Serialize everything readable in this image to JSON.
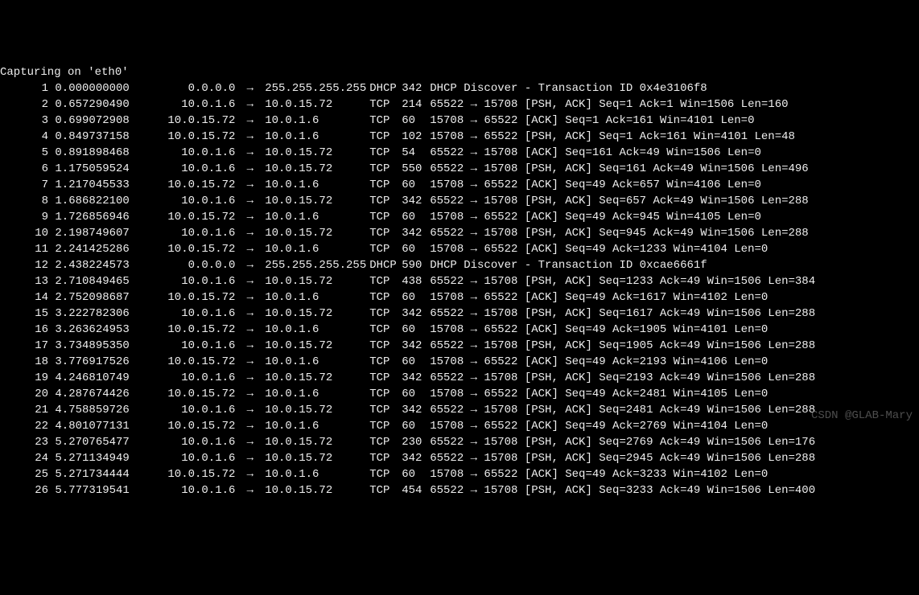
{
  "header": "Capturing on 'eth0'",
  "arrow": "→",
  "watermark": "CSDN @GLAB-Mary",
  "packets": [
    {
      "no": "1",
      "time": "0.000000000",
      "src": "0.0.0.0",
      "dst": "255.255.255.255",
      "proto": "DHCP",
      "len": "342",
      "info": "DHCP Discover - Transaction ID 0x4e3106f8"
    },
    {
      "no": "2",
      "time": "0.657290490",
      "src": "10.0.1.6",
      "dst": "10.0.15.72",
      "proto": "TCP",
      "len": "214",
      "info": "65522 → 15708 [PSH, ACK] Seq=1 Ack=1 Win=1506 Len=160"
    },
    {
      "no": "3",
      "time": "0.699072908",
      "src": "10.0.15.72",
      "dst": "10.0.1.6",
      "proto": "TCP",
      "len": "60",
      "info": "15708 → 65522 [ACK] Seq=1 Ack=161 Win=4101 Len=0"
    },
    {
      "no": "4",
      "time": "0.849737158",
      "src": "10.0.15.72",
      "dst": "10.0.1.6",
      "proto": "TCP",
      "len": "102",
      "info": "15708 → 65522 [PSH, ACK] Seq=1 Ack=161 Win=4101 Len=48"
    },
    {
      "no": "5",
      "time": "0.891898468",
      "src": "10.0.1.6",
      "dst": "10.0.15.72",
      "proto": "TCP",
      "len": "54",
      "info": "65522 → 15708 [ACK] Seq=161 Ack=49 Win=1506 Len=0"
    },
    {
      "no": "6",
      "time": "1.175059524",
      "src": "10.0.1.6",
      "dst": "10.0.15.72",
      "proto": "TCP",
      "len": "550",
      "info": "65522 → 15708 [PSH, ACK] Seq=161 Ack=49 Win=1506 Len=496"
    },
    {
      "no": "7",
      "time": "1.217045533",
      "src": "10.0.15.72",
      "dst": "10.0.1.6",
      "proto": "TCP",
      "len": "60",
      "info": "15708 → 65522 [ACK] Seq=49 Ack=657 Win=4106 Len=0"
    },
    {
      "no": "8",
      "time": "1.686822100",
      "src": "10.0.1.6",
      "dst": "10.0.15.72",
      "proto": "TCP",
      "len": "342",
      "info": "65522 → 15708 [PSH, ACK] Seq=657 Ack=49 Win=1506 Len=288"
    },
    {
      "no": "9",
      "time": "1.726856946",
      "src": "10.0.15.72",
      "dst": "10.0.1.6",
      "proto": "TCP",
      "len": "60",
      "info": "15708 → 65522 [ACK] Seq=49 Ack=945 Win=4105 Len=0"
    },
    {
      "no": "10",
      "time": "2.198749607",
      "src": "10.0.1.6",
      "dst": "10.0.15.72",
      "proto": "TCP",
      "len": "342",
      "info": "65522 → 15708 [PSH, ACK] Seq=945 Ack=49 Win=1506 Len=288"
    },
    {
      "no": "11",
      "time": "2.241425286",
      "src": "10.0.15.72",
      "dst": "10.0.1.6",
      "proto": "TCP",
      "len": "60",
      "info": "15708 → 65522 [ACK] Seq=49 Ack=1233 Win=4104 Len=0"
    },
    {
      "no": "12",
      "time": "2.438224573",
      "src": "0.0.0.0",
      "dst": "255.255.255.255",
      "proto": "DHCP",
      "len": "590",
      "info": "DHCP Discover - Transaction ID 0xcae6661f"
    },
    {
      "no": "13",
      "time": "2.710849465",
      "src": "10.0.1.6",
      "dst": "10.0.15.72",
      "proto": "TCP",
      "len": "438",
      "info": "65522 → 15708 [PSH, ACK] Seq=1233 Ack=49 Win=1506 Len=384"
    },
    {
      "no": "14",
      "time": "2.752098687",
      "src": "10.0.15.72",
      "dst": "10.0.1.6",
      "proto": "TCP",
      "len": "60",
      "info": "15708 → 65522 [ACK] Seq=49 Ack=1617 Win=4102 Len=0"
    },
    {
      "no": "15",
      "time": "3.222782306",
      "src": "10.0.1.6",
      "dst": "10.0.15.72",
      "proto": "TCP",
      "len": "342",
      "info": "65522 → 15708 [PSH, ACK] Seq=1617 Ack=49 Win=1506 Len=288"
    },
    {
      "no": "16",
      "time": "3.263624953",
      "src": "10.0.15.72",
      "dst": "10.0.1.6",
      "proto": "TCP",
      "len": "60",
      "info": "15708 → 65522 [ACK] Seq=49 Ack=1905 Win=4101 Len=0"
    },
    {
      "no": "17",
      "time": "3.734895350",
      "src": "10.0.1.6",
      "dst": "10.0.15.72",
      "proto": "TCP",
      "len": "342",
      "info": "65522 → 15708 [PSH, ACK] Seq=1905 Ack=49 Win=1506 Len=288"
    },
    {
      "no": "18",
      "time": "3.776917526",
      "src": "10.0.15.72",
      "dst": "10.0.1.6",
      "proto": "TCP",
      "len": "60",
      "info": "15708 → 65522 [ACK] Seq=49 Ack=2193 Win=4106 Len=0"
    },
    {
      "no": "19",
      "time": "4.246810749",
      "src": "10.0.1.6",
      "dst": "10.0.15.72",
      "proto": "TCP",
      "len": "342",
      "info": "65522 → 15708 [PSH, ACK] Seq=2193 Ack=49 Win=1506 Len=288"
    },
    {
      "no": "20",
      "time": "4.287674426",
      "src": "10.0.15.72",
      "dst": "10.0.1.6",
      "proto": "TCP",
      "len": "60",
      "info": "15708 → 65522 [ACK] Seq=49 Ack=2481 Win=4105 Len=0"
    },
    {
      "no": "21",
      "time": "4.758859726",
      "src": "10.0.1.6",
      "dst": "10.0.15.72",
      "proto": "TCP",
      "len": "342",
      "info": "65522 → 15708 [PSH, ACK] Seq=2481 Ack=49 Win=1506 Len=288"
    },
    {
      "no": "22",
      "time": "4.801077131",
      "src": "10.0.15.72",
      "dst": "10.0.1.6",
      "proto": "TCP",
      "len": "60",
      "info": "15708 → 65522 [ACK] Seq=49 Ack=2769 Win=4104 Len=0"
    },
    {
      "no": "23",
      "time": "5.270765477",
      "src": "10.0.1.6",
      "dst": "10.0.15.72",
      "proto": "TCP",
      "len": "230",
      "info": "65522 → 15708 [PSH, ACK] Seq=2769 Ack=49 Win=1506 Len=176"
    },
    {
      "no": "24",
      "time": "5.271134949",
      "src": "10.0.1.6",
      "dst": "10.0.15.72",
      "proto": "TCP",
      "len": "342",
      "info": "65522 → 15708 [PSH, ACK] Seq=2945 Ack=49 Win=1506 Len=288"
    },
    {
      "no": "25",
      "time": "5.271734444",
      "src": "10.0.15.72",
      "dst": "10.0.1.6",
      "proto": "TCP",
      "len": "60",
      "info": "15708 → 65522 [ACK] Seq=49 Ack=3233 Win=4102 Len=0"
    },
    {
      "no": "26",
      "time": "5.777319541",
      "src": "10.0.1.6",
      "dst": "10.0.15.72",
      "proto": "TCP",
      "len": "454",
      "info": "65522 → 15708 [PSH, ACK] Seq=3233 Ack=49 Win=1506 Len=400"
    }
  ]
}
